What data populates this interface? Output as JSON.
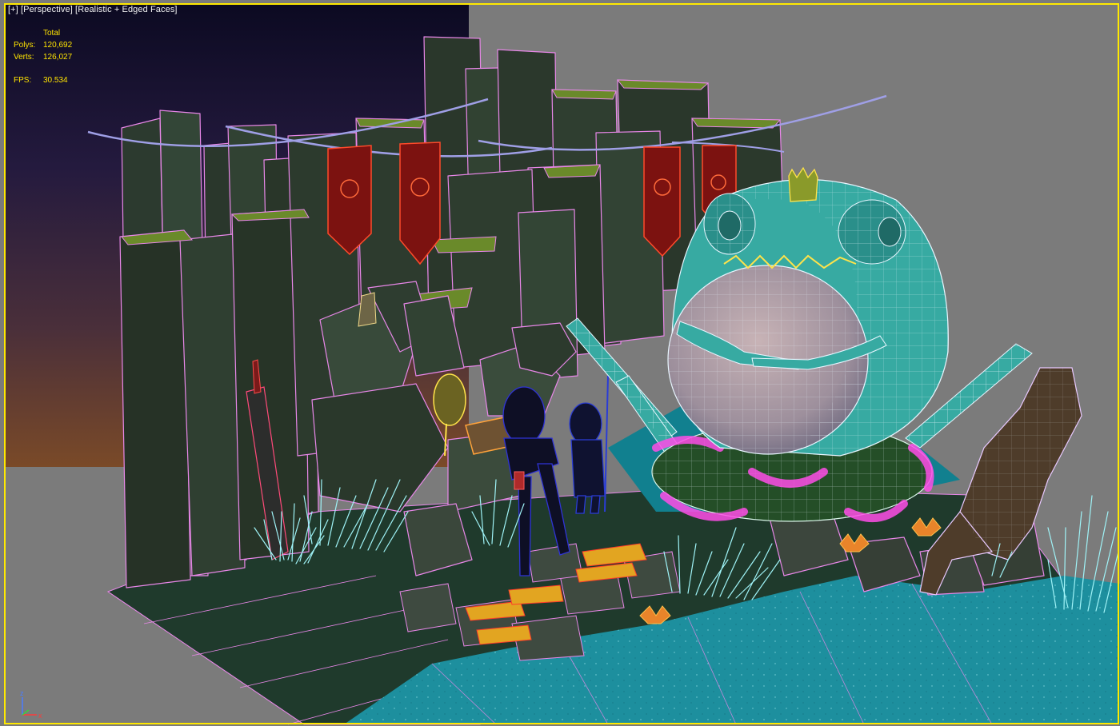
{
  "viewport": {
    "menu_label": "[+]",
    "view_label": "[Perspective]",
    "shading_label": "[Realistic + Edged Faces]"
  },
  "stats": {
    "header": "Total",
    "polys_label": "Polys:",
    "polys_value": "120,692",
    "verts_label": "Verts:",
    "verts_value": "126,027",
    "fps_label": "FPS:",
    "fps_value": "30.534"
  },
  "axis_gizmo": {
    "z_label": "z",
    "x_label": "x"
  },
  "colors": {
    "viewport_border": "#ffe900",
    "background_gray": "#7b7b7b",
    "stats_text": "#ffe400",
    "wire_pink": "#e887e8",
    "rock_dark": "#2c3a2f",
    "grass_cyan": "#9ff3f7",
    "water": "#1d8f9e",
    "frog_teal": "#37aaa2",
    "banner_red": "#7c1210"
  }
}
